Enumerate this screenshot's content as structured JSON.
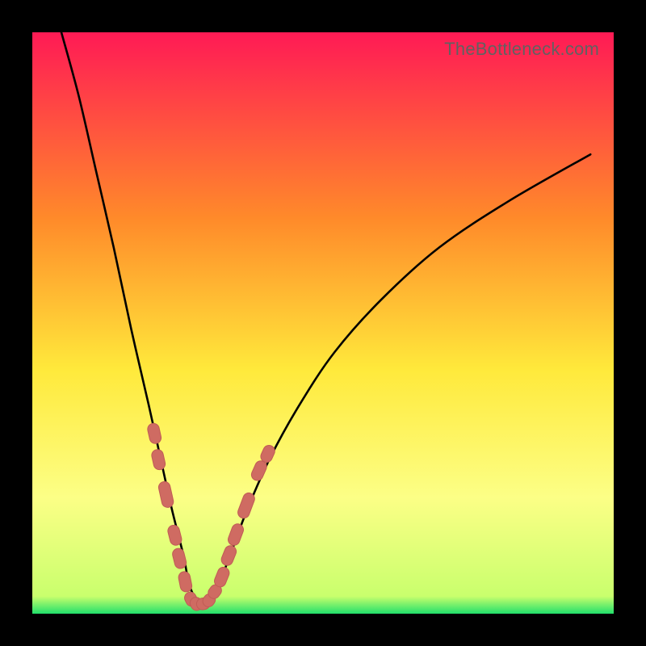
{
  "watermark": {
    "text": "TheBottleneck.com"
  },
  "colors": {
    "frame_bg": "#000000",
    "gradient_top": "#ff1a55",
    "gradient_mid1": "#ff8a2a",
    "gradient_mid2": "#ffe93b",
    "gradient_mid3": "#fcff86",
    "gradient_bottom": "#21e06b",
    "curve_color": "#000000",
    "marker_fill": "#cf6b62",
    "marker_stroke": "#c05c55"
  },
  "chart_data": {
    "type": "line",
    "title": "",
    "xlabel": "",
    "ylabel": "",
    "xlim": [
      0,
      100
    ],
    "ylim": [
      0,
      100
    ],
    "comment": "Single V-shaped bottleneck curve. x roughly corresponds to a hardware balance ratio (percent of axis width); y is bottleneck magnitude (percent). Minimum at x≈28.5.",
    "series": [
      {
        "name": "bottleneck-curve",
        "x": [
          5,
          8,
          11,
          14,
          17,
          20,
          22,
          24,
          26,
          27,
          28.5,
          30,
          32,
          34,
          37,
          41,
          46,
          52,
          60,
          70,
          82,
          96
        ],
        "values": [
          100,
          89,
          76,
          63,
          49,
          36,
          27,
          18,
          10,
          5,
          2,
          2.3,
          5,
          10,
          18,
          27,
          36,
          45,
          54,
          63,
          71,
          79
        ]
      }
    ],
    "highlight_markers": {
      "comment": "Salmon capsule markers clustered around the trough of the curve (left and right walls).",
      "points": [
        {
          "x": 21.0,
          "y": 31.0,
          "len": 3.5
        },
        {
          "x": 21.7,
          "y": 26.5,
          "len": 3.5
        },
        {
          "x": 23.0,
          "y": 20.5,
          "len": 4.5
        },
        {
          "x": 24.5,
          "y": 13.5,
          "len": 3.5
        },
        {
          "x": 25.3,
          "y": 9.5,
          "len": 3.5
        },
        {
          "x": 26.3,
          "y": 5.5,
          "len": 3.5
        },
        {
          "x": 27.3,
          "y": 2.5,
          "len": 2.5
        },
        {
          "x": 28.2,
          "y": 1.7,
          "len": 2.3
        },
        {
          "x": 29.4,
          "y": 1.7,
          "len": 2.3
        },
        {
          "x": 30.4,
          "y": 2.3,
          "len": 2.3
        },
        {
          "x": 31.4,
          "y": 3.8,
          "len": 2.5
        },
        {
          "x": 32.6,
          "y": 6.3,
          "len": 3.5
        },
        {
          "x": 33.8,
          "y": 10.0,
          "len": 3.5
        },
        {
          "x": 35.0,
          "y": 13.6,
          "len": 3.8
        },
        {
          "x": 36.8,
          "y": 18.6,
          "len": 4.5
        },
        {
          "x": 39.0,
          "y": 24.6,
          "len": 3.5
        },
        {
          "x": 40.5,
          "y": 27.5,
          "len": 3.0
        }
      ]
    }
  }
}
